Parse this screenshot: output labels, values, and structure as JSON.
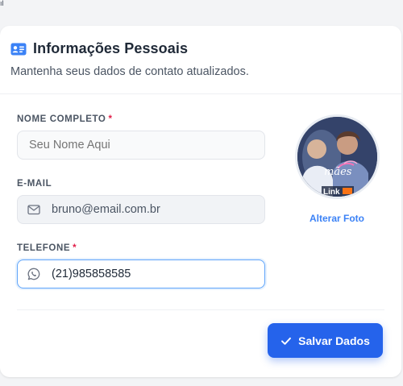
{
  "corner_mark": "ıl",
  "section": {
    "title": "Informações Pessoais",
    "subtitle": "Mantenha seus dados de contato atualizados.",
    "icon": "id-card-icon"
  },
  "form": {
    "name": {
      "label": "NOME COMPLETO",
      "required_mark": "*",
      "value": "",
      "placeholder": "Seu Nome Aqui"
    },
    "email": {
      "label": "E-MAIL",
      "value": "bruno@email.com.br",
      "icon": "mail-icon"
    },
    "phone": {
      "label": "TELEFONE",
      "required_mark": "*",
      "value": "(21)985858585",
      "icon": "whatsapp-icon"
    }
  },
  "photo": {
    "change_label": "Alterar Foto",
    "overlay_text": {
      "script": "mães",
      "brand": "Link"
    }
  },
  "actions": {
    "save_label": "Salvar Dados",
    "save_icon": "check-icon"
  },
  "colors": {
    "accent": "#2563eb",
    "link": "#3b82f6",
    "required": "#e11d48",
    "focus_border": "#60a5fa"
  }
}
